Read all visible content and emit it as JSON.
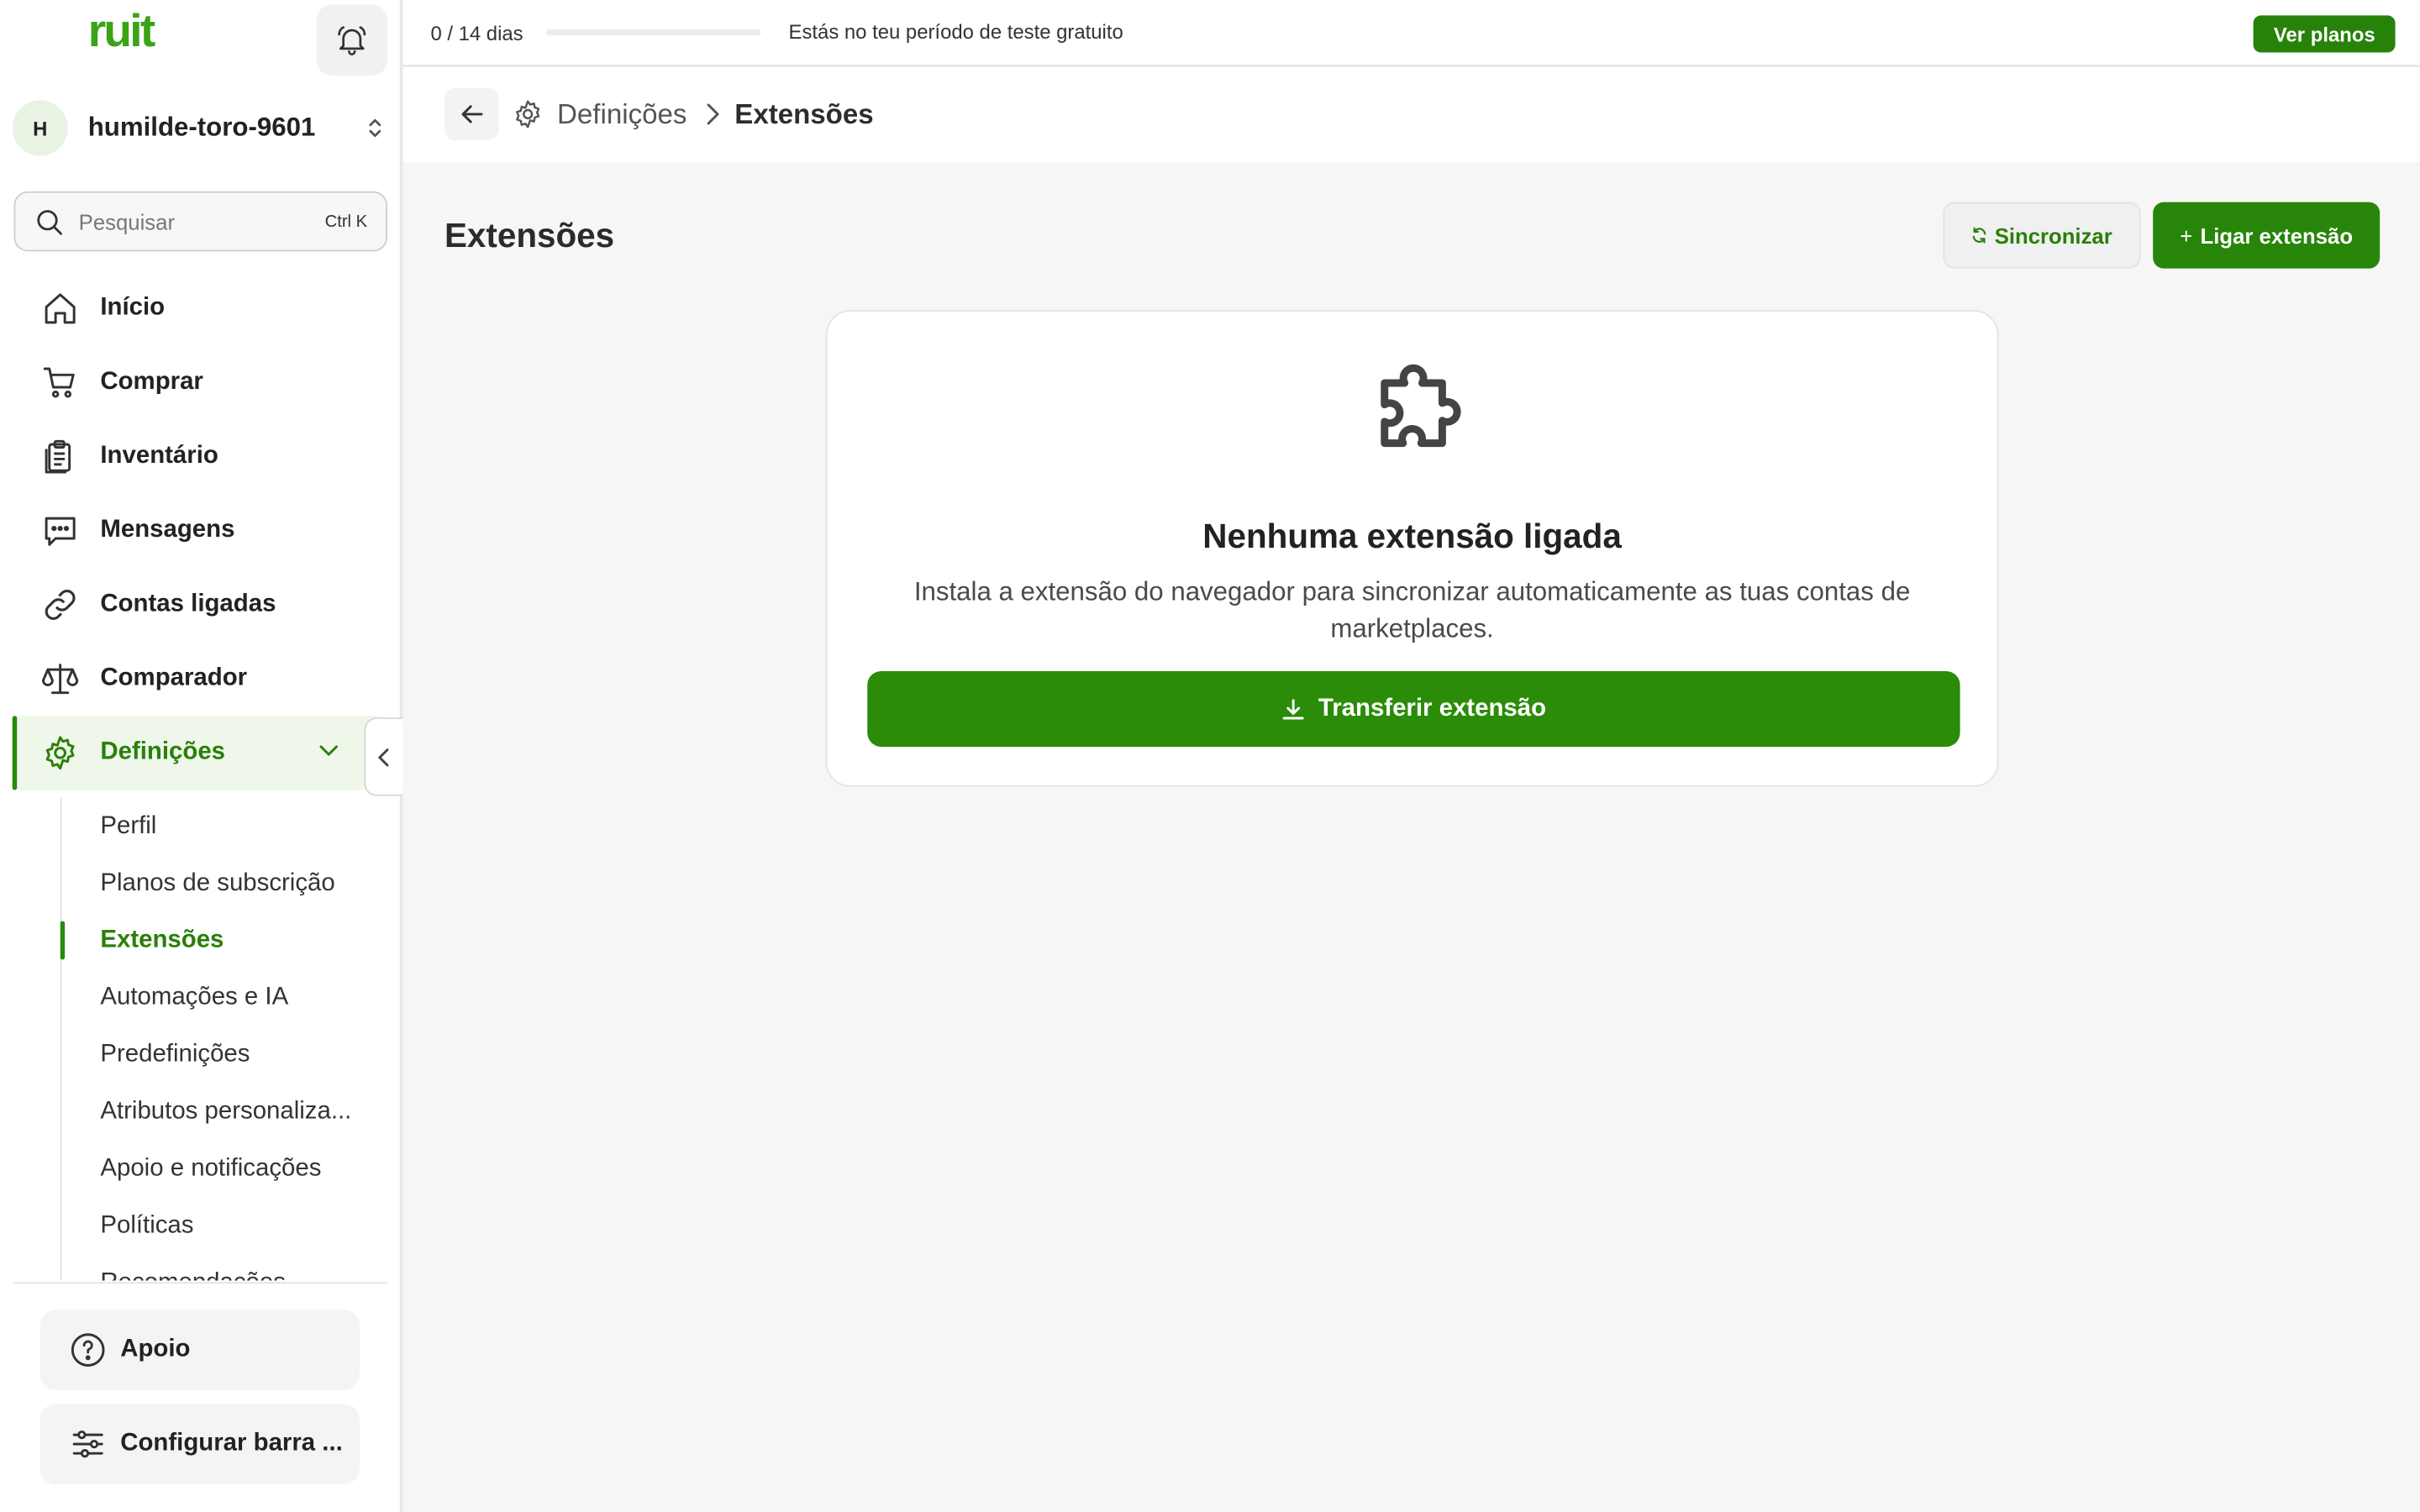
{
  "app": {
    "logo": "ruit"
  },
  "trial": {
    "count": "0 / 14 dias",
    "progress": 0,
    "message": "Estás no teu período de teste gratuito",
    "plans_label": "Ver planos"
  },
  "workspace": {
    "initial": "H",
    "name": "humilde-toro-9601"
  },
  "search": {
    "placeholder": "Pesquisar",
    "shortcut": "Ctrl K"
  },
  "nav": {
    "items": [
      {
        "label": "Início",
        "icon": "home-icon"
      },
      {
        "label": "Comprar",
        "icon": "cart-icon"
      },
      {
        "label": "Inventário",
        "icon": "clipboard-icon"
      },
      {
        "label": "Mensagens",
        "icon": "chat-icon"
      },
      {
        "label": "Contas ligadas",
        "icon": "link-icon"
      },
      {
        "label": "Comparador",
        "icon": "scale-icon"
      },
      {
        "label": "Definições",
        "icon": "gear-icon",
        "active": true
      }
    ],
    "sub_items": [
      {
        "label": "Perfil"
      },
      {
        "label": "Planos de subscrição"
      },
      {
        "label": "Extensões",
        "active": true
      },
      {
        "label": "Automações e IA"
      },
      {
        "label": "Predefinições"
      },
      {
        "label": "Atributos personaliza..."
      },
      {
        "label": "Apoio e notificações"
      },
      {
        "label": "Políticas"
      },
      {
        "label": "Recomendações"
      }
    ]
  },
  "footer": {
    "support_label": "Apoio",
    "configure_label": "Configurar barra ..."
  },
  "breadcrumb": {
    "parent": "Definições",
    "current": "Extensões"
  },
  "main": {
    "title": "Extensões",
    "sync_label": "Sincronizar",
    "connect_label": "Ligar extensão",
    "empty": {
      "title": "Nenhuma extensão ligada",
      "description": "Instala a extensão do navegador para sincronizar automaticamente as tuas contas de marketplaces.",
      "download_label": "Transferir extensão"
    }
  },
  "colors": {
    "brand": "#2a8a0b",
    "logo": "#3aa317"
  }
}
